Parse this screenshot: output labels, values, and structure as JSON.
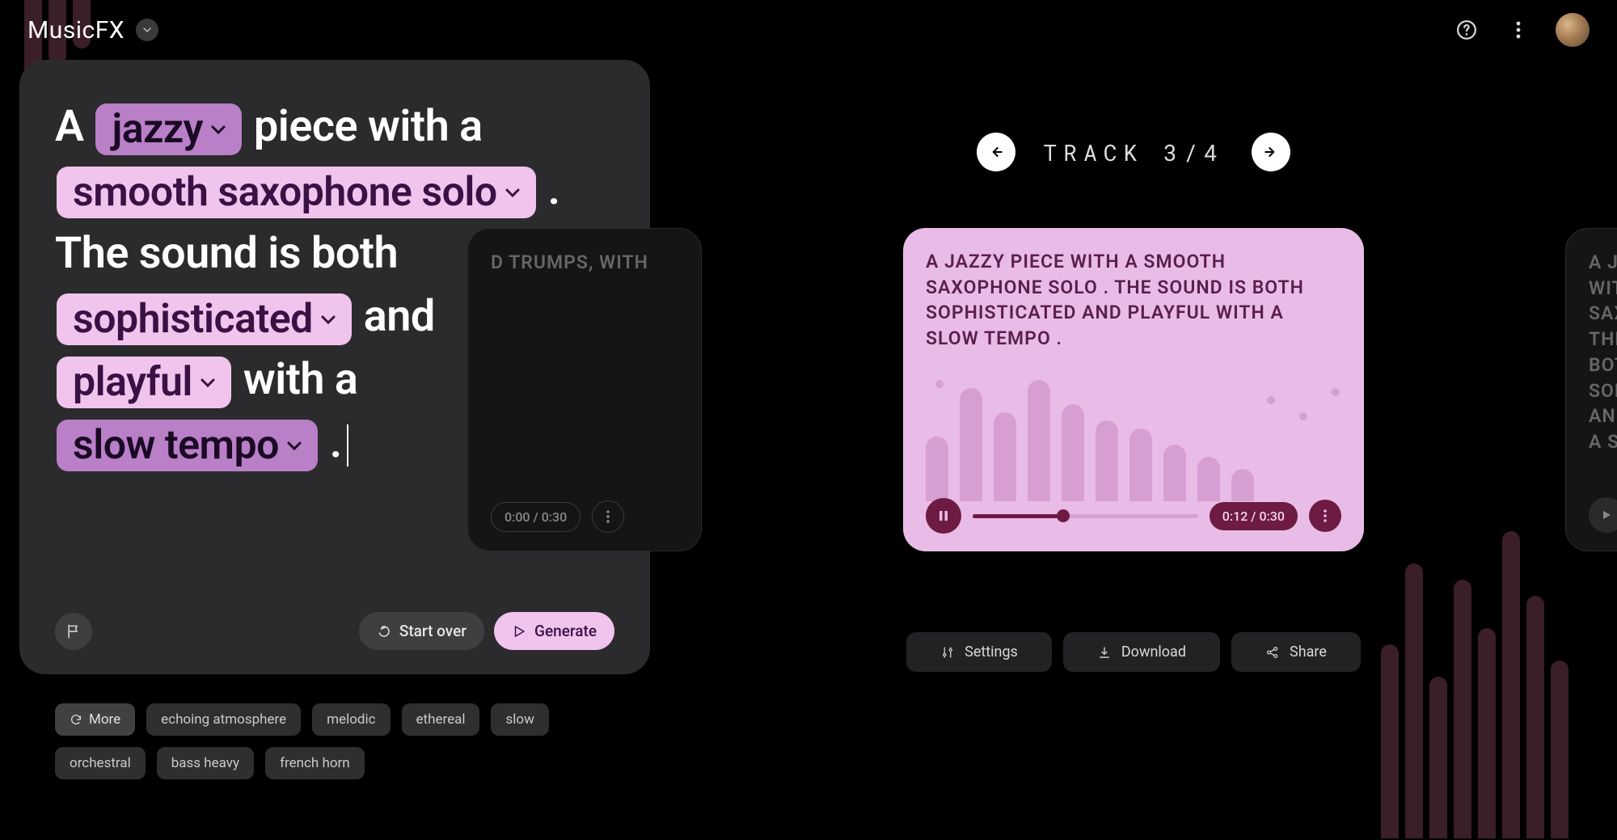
{
  "header": {
    "title": "MusicFX"
  },
  "prompt": {
    "segments": [
      {
        "type": "text",
        "value": "A "
      },
      {
        "type": "chip",
        "value": "jazzy",
        "variant": "dark"
      },
      {
        "type": "text",
        "value": " piece with a "
      },
      {
        "type": "chip",
        "value": "smooth saxophone solo",
        "variant": "light"
      },
      {
        "type": "text",
        "value": " . The sound is both "
      },
      {
        "type": "chip",
        "value": "sophisticated",
        "variant": "light"
      },
      {
        "type": "text",
        "value": " and "
      },
      {
        "type": "chip",
        "value": "playful",
        "variant": "light"
      },
      {
        "type": "text",
        "value": " with a "
      },
      {
        "type": "chip",
        "value": "slow tempo",
        "variant": "dark"
      },
      {
        "type": "text",
        "value": " ."
      }
    ],
    "start_over_label": "Start over",
    "generate_label": "Generate"
  },
  "tags": {
    "more_label": "More",
    "items": [
      "echoing atmosphere",
      "melodic",
      "ethereal",
      "slow",
      "orchestral",
      "bass heavy",
      "french horn"
    ]
  },
  "tracks": {
    "nav_label": "TRACK",
    "current": 3,
    "total": 4,
    "left_peek_desc": "D TRUMPS, WITH",
    "left_peek_time": "0:00 / 0:30",
    "active_desc": "A JAZZY PIECE WITH A SMOOTH SAXOPHONE SOLO . THE SOUND IS BOTH SOPHISTICATED AND PLAYFUL WITH A SLOW TEMPO .",
    "active_time": "0:12 / 0:30",
    "active_progress_pct": 40,
    "right_peek_desc": "A JAZZY PIECE WITH A SMOOTH SAXOPHONE SOLO . THE SOUND IS BOTH SOPHISTICATED AND PLAYFUL WITH A SLOW TEMPO ."
  },
  "actions": {
    "settings": "Settings",
    "download": "Download",
    "share": "Share"
  }
}
